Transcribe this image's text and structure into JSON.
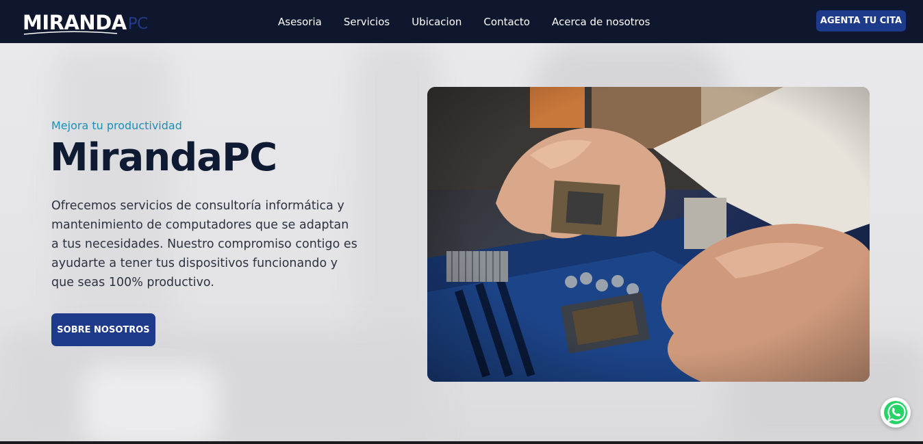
{
  "brand": {
    "logo_main": "MIRANDA",
    "logo_accent": "PC",
    "accent_color": "#1e3a8a",
    "nav_bg_color": "#0f172e"
  },
  "nav": {
    "links": [
      {
        "label": "Asesoria"
      },
      {
        "label": "Servicios"
      },
      {
        "label": "Ubicacion"
      },
      {
        "label": "Contacto"
      },
      {
        "label": "Acerca de nosotros"
      }
    ],
    "cta_label": "AGENTA TU CITA"
  },
  "hero": {
    "eyebrow": "Mejora tu productividad",
    "title": "MirandaPC",
    "description": "Ofrecemos servicios de consultoría informática y mantenimiento de computadores que se adaptan a tus necesidades. Nuestro compromiso contigo es ayudarte a tener tus dispositivos funcionando y que seas 100% productivo.",
    "cta_label": "SOBRE NOSOTROS",
    "image_icon": "motherboard-cpu-photo"
  },
  "floating": {
    "whatsapp_icon": "whatsapp-icon",
    "whatsapp_color": "#25d366"
  }
}
